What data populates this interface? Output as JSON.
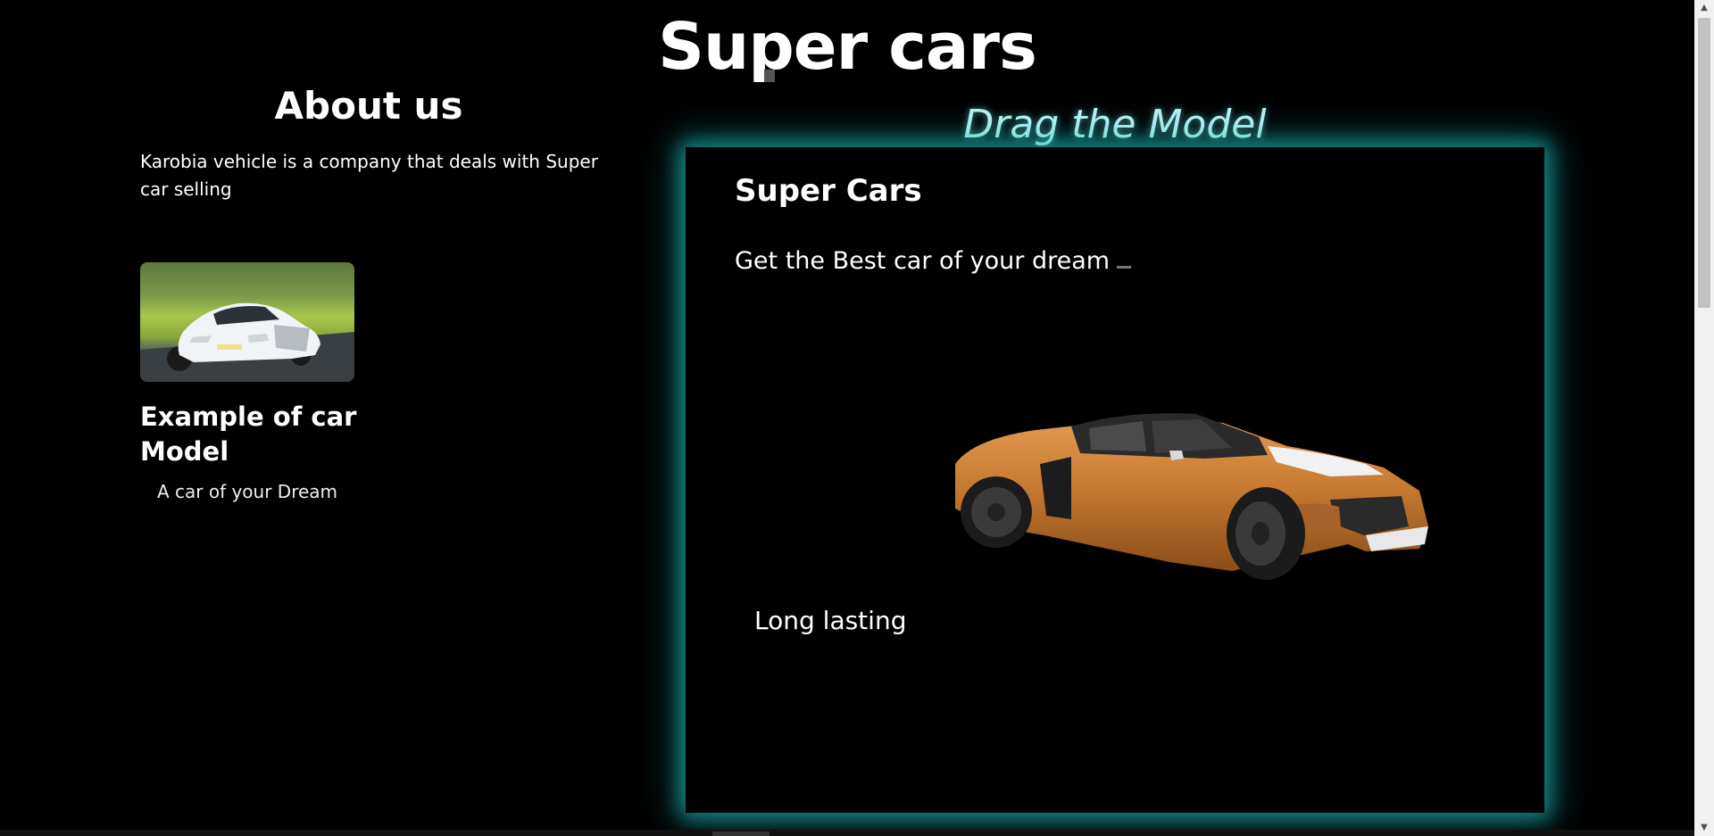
{
  "header": {
    "title": "Super cars"
  },
  "about": {
    "title": "About us",
    "text": "Karobia vehicle is a company that deals with Super car selling",
    "example_title": "Example of car Model",
    "example_caption": "A car of your Dream"
  },
  "model_viewer": {
    "label": "Drag the Model",
    "title": "Super Cars",
    "subtitle": "Get the Best car of your dream",
    "feature": "Long lasting",
    "accent_color": "#1ec8c8"
  },
  "icons": {
    "scroll_up": "▲",
    "scroll_down": "▼"
  }
}
